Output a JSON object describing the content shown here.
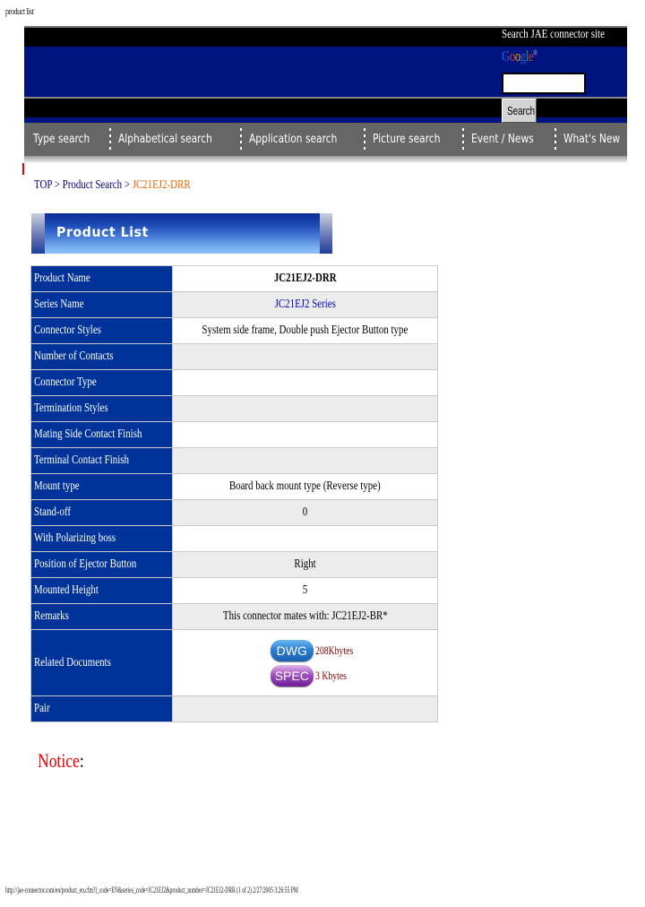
{
  "page_header": "product list",
  "search_box": {
    "label": "Search JAE connector site",
    "logo": [
      "G",
      "o",
      "o",
      "g",
      "l",
      "e"
    ],
    "logo_mark": "®",
    "input_value": "",
    "button_label": "Search"
  },
  "nav": {
    "items": [
      {
        "label": "Type search"
      },
      {
        "label": "Alphabetical search"
      },
      {
        "label": "Application search"
      },
      {
        "label": "Picture search"
      },
      {
        "label": "Event / News"
      },
      {
        "label": "What's New"
      }
    ]
  },
  "breadcrumb": {
    "items": [
      "TOP",
      "Product Search"
    ],
    "separator": ">",
    "current": "JC21EJ2-DRR"
  },
  "section_title": "Product List",
  "spec_table": {
    "rows": [
      {
        "label": "Product Name",
        "value": "JC21EJ2-DRR"
      },
      {
        "label": "Series Name",
        "value": "JC21EJ2 Series"
      },
      {
        "label": "Connector Styles",
        "value": "System side frame, Double push Ejector Button type"
      },
      {
        "label": "Number of Contacts",
        "value": ""
      },
      {
        "label": "Connector Type",
        "value": ""
      },
      {
        "label": "Termination Styles",
        "value": ""
      },
      {
        "label": "Mating Side Contact Finish",
        "value": ""
      },
      {
        "label": "Terminal Contact Finish",
        "value": ""
      },
      {
        "label": "Mount type",
        "value": "Board back mount type (Reverse type)"
      },
      {
        "label": "Stand-off",
        "value": "0"
      },
      {
        "label": "With Polarizing boss",
        "value": ""
      },
      {
        "label": "Position of Ejector Button",
        "value": "Right"
      },
      {
        "label": "Mounted Height",
        "value": "5"
      },
      {
        "label": "Remarks",
        "value": "This connector mates with: JC21EJ2-BR*"
      },
      {
        "label": "Related Documents",
        "documents": [
          {
            "label": "DWG",
            "size": "208Kbytes",
            "color": "#2d7fd0"
          },
          {
            "label": "SPEC",
            "size": "3 Kbytes",
            "color": "#8a35b0"
          }
        ]
      },
      {
        "label": "Pair",
        "value": ""
      }
    ]
  },
  "notice": {
    "label": "Notice",
    "colon": ":"
  },
  "footer_url": "http://jae-connector.com/en/product_en.cfm?l_code=EN&series_code=JC21EJ2&product_number=JC21EJ2-DRR (1 of 2) 2/27/2005 3:26:55 PM",
  "colors": {
    "banner_blue": "#001480",
    "nav_gray": "#666666",
    "label_blue": "#003399",
    "breadcrumb_current": "#ee6600",
    "notice_red": "#ee0000"
  }
}
